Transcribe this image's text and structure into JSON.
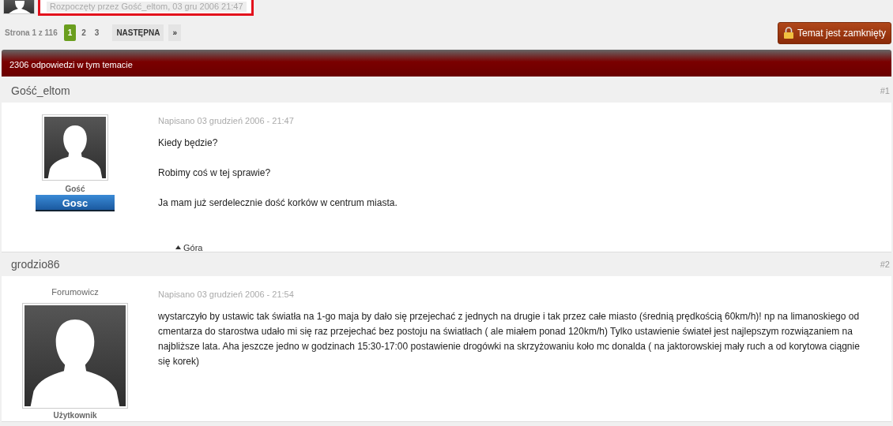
{
  "topic_started": "Rozpoczęty przez Gość_eltom, 03 gru 2006 21:47",
  "pagination": {
    "label": "Strona 1 z 116",
    "pages": [
      {
        "label": "1",
        "selected": true
      },
      {
        "label": "2",
        "selected": false
      },
      {
        "label": "3",
        "selected": false
      }
    ],
    "next": "NASTĘPNA",
    "last": "»"
  },
  "locked_button": "Temat jest zamknięty",
  "replies_bar": "2306 odpowiedzi w tym temacie",
  "posts": [
    {
      "author": "Gość_eltom",
      "number": "#1",
      "group": "Gość",
      "badge": "Gosc",
      "date": "Napisano 03 grudzień 2006 - 21:47",
      "paragraphs": [
        "Kiedy będzie?",
        "Robimy coś w tej sprawie?",
        "Ja mam już serdelecznie dość korków w centrum miasta."
      ],
      "top_link": "Góra"
    },
    {
      "author": "grodzio86",
      "number": "#2",
      "rank_title": "Forumowicz",
      "group": "Użytkownik",
      "date": "Napisano 03 grudzień 2006 - 21:54",
      "paragraphs": [
        "wystarczyło by ustawic tak światła na 1-go maja by dało się przejechać z jednych na drugie i tak przez całe miasto (średnią prędkością 60km/h)! np na limanoskiego od cmentarza do starostwa udało mi się raz przejechać bez postoju na światłach ( ale miałem ponad 120km/h) Tylko ustawienie świateł jest najlepszym rozwiązaniem na najbliższe lata. Aha jeszcze jedno w godzinach 15:30-17:00 postawienie drogówki na skrzyżowaniu koło mc donalda ( na jaktorowskiej mały ruch a od korytowa ciągnie się korek)"
      ]
    }
  ]
}
